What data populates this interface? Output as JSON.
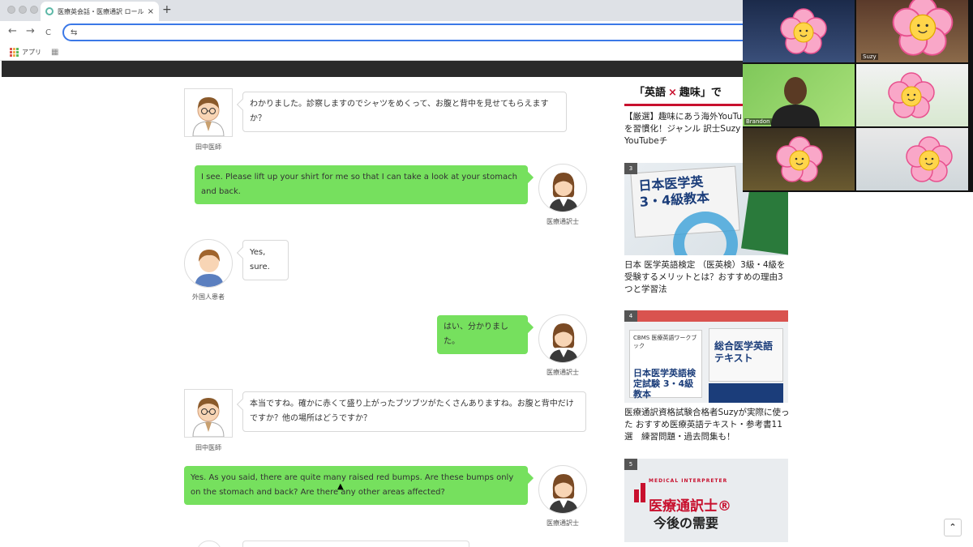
{
  "browser": {
    "tab_title": "医療英会話・医療通訳 ロールプレ",
    "tab_close": "×",
    "new_tab": "+",
    "back_icon": "←",
    "forward_icon": "→",
    "reload_icon": "C",
    "site_settings_icon": "⇆",
    "address_value": "",
    "bookmark_apps": "アプリ"
  },
  "chat": [
    {
      "speaker": "田中医師",
      "text": "わかりました。診察しますのでシャツをめくって、お腹と背中を見せてもらえますか？"
    },
    {
      "speaker": "医療通訳士",
      "text": "I see. Please lift up your shirt for me so that I can take a look at your stomach and back."
    },
    {
      "speaker": "外国人患者",
      "text": "Yes, sure."
    },
    {
      "speaker": "医療通訳士",
      "text": "はい、分かりました。"
    },
    {
      "speaker": "田中医師",
      "text": "本当ですね。確かに赤くて盛り上がったブツブツがたくさんありますね。お腹と背中だけですか？他の場所はどうですか？"
    },
    {
      "speaker": "医療通訳士",
      "text": "Yes. As you said, there are quite many raised red bumps. Are these bumps only on the stomach and back? Are there any other areas affected?"
    }
  ],
  "sidebar": {
    "banner_text_1": "「英語",
    "banner_x": "×",
    "banner_text_2": "趣味」で",
    "item2_title": "【厳選】趣味にあう海外YouTube 英語学習を習慣化！ジャンル 訳士Suzy おすすめYouTubeチ",
    "item3_rank": "3",
    "item3_book": "日本医学英 3・4級教本",
    "item3_title": "日本 医学英語検定 （医英検）3級・4級を受験するメリットとは？おすすめの理由3つと学習法",
    "item4_rank": "4",
    "item4_book_1": "CBMS 医療英語ワークブック",
    "item4_book_2": "総合医学英語 テキスト",
    "item4_book_3": "日本医学英語検定試験 3・4級教本",
    "item4_title": "医療通訳資格試験合格者Suzyが実際に使った おすすめ医療英語テキスト・参考書11選　練習問題・過去問集も！",
    "item5_rank": "5",
    "item5_banner_small": "MEDICAL INTERPRETER",
    "item5_banner_1": "医療通訳士®",
    "item5_banner_2": "今後の需要"
  },
  "video": {
    "name_suzy": "Suzy",
    "name_brandon": "Brandon"
  },
  "scroll_top_icon": "⌃",
  "colors": {
    "green_bubble": "#76e05e",
    "accent_blue": "#3b78e7",
    "banner_red": "#c8102e"
  }
}
